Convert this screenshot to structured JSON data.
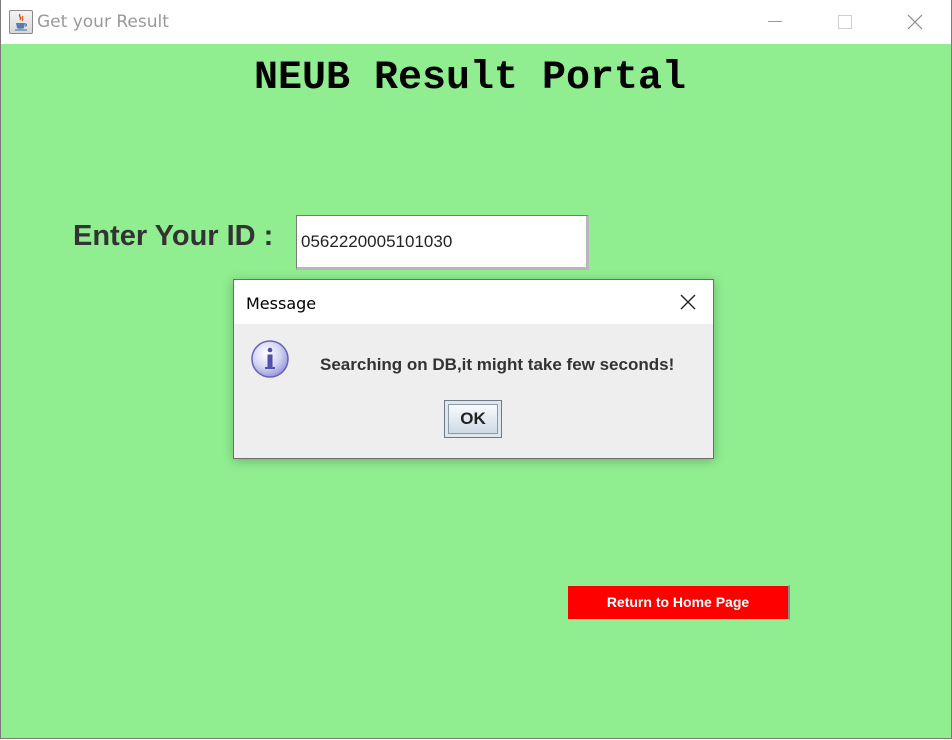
{
  "window": {
    "title": "Get your Result",
    "icon": "java-icon"
  },
  "page": {
    "heading": "NEUB Result Portal",
    "id_label": "Enter Your ID :",
    "id_value": "0562220005101030",
    "home_button_label": "Return to Home Page",
    "background_color": "#90ee90",
    "home_button_color": "#ff0000"
  },
  "dialog": {
    "title": "Message",
    "icon": "info-icon",
    "message": "Searching on DB,it might take few seconds!",
    "ok_label": "OK"
  }
}
